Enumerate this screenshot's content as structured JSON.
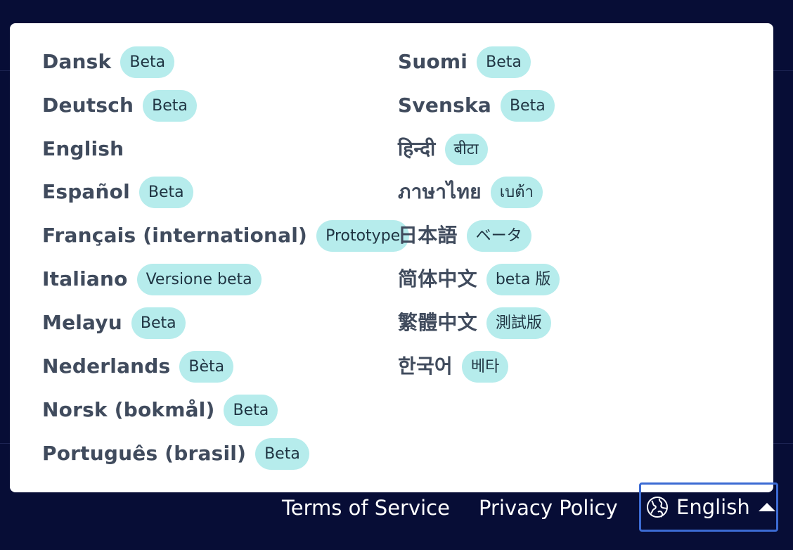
{
  "languages_left": [
    {
      "name": "Dansk",
      "badge": "Beta"
    },
    {
      "name": "Deutsch",
      "badge": "Beta"
    },
    {
      "name": "English",
      "badge": ""
    },
    {
      "name": "Español",
      "badge": "Beta"
    },
    {
      "name": "Français (international)",
      "badge": "Prototype"
    },
    {
      "name": "Italiano",
      "badge": "Versione beta"
    },
    {
      "name": "Melayu",
      "badge": "Beta"
    },
    {
      "name": "Nederlands",
      "badge": "Bèta"
    },
    {
      "name": "Norsk (bokmål)",
      "badge": "Beta"
    },
    {
      "name": "Português (brasil)",
      "badge": "Beta"
    }
  ],
  "languages_right": [
    {
      "name": "Suomi",
      "badge": "Beta"
    },
    {
      "name": "Svenska",
      "badge": "Beta"
    },
    {
      "name": "हिन्दी",
      "badge": "बीटा"
    },
    {
      "name": "ภาษาไทย",
      "badge": "เบต้า"
    },
    {
      "name": "日本語",
      "badge": "ベータ"
    },
    {
      "name": "简体中文",
      "badge": "beta 版"
    },
    {
      "name": "繁體中文",
      "badge": "測試版"
    },
    {
      "name": "한국어",
      "badge": "베타"
    }
  ],
  "footer": {
    "terms": "Terms of Service",
    "privacy": "Privacy Policy",
    "language_toggle": "English",
    "language_icon": "globe-icon",
    "caret_icon": "caret-up-icon"
  },
  "colors": {
    "background": "#070d36",
    "popover": "#ffffff",
    "badge_bg": "#b6ecec",
    "text": "#404b5d",
    "focus_outline": "#3c6bd3"
  }
}
